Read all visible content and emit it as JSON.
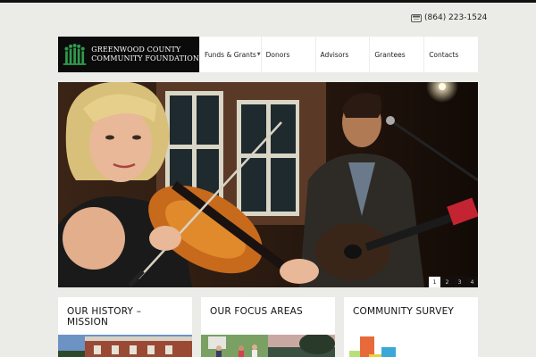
{
  "phone": {
    "number": "(864) 223-1524",
    "icon": "phone-icon"
  },
  "logo": {
    "line1": "GREENWOOD COUNTY",
    "line2": "COMMUNITY FOUNDATION",
    "mark_icon": "tree-people-icon",
    "mark_color": "#2f9a4d"
  },
  "nav": {
    "items": [
      {
        "label": "Funds & Grants",
        "has_dropdown": true
      },
      {
        "label": "Donors"
      },
      {
        "label": "Advisors"
      },
      {
        "label": "Grantees"
      },
      {
        "label": "Contacts"
      }
    ]
  },
  "hero": {
    "pager": [
      "1",
      "2",
      "3",
      "4"
    ],
    "active_slide": 1
  },
  "cards": [
    {
      "title": "OUR HISTORY – MISSION"
    },
    {
      "title": "OUR FOCUS AREAS"
    },
    {
      "title": "COMMUNITY SURVEY"
    }
  ],
  "colors": {
    "background": "#ebebe7",
    "logo_bg": "#0b0b0b",
    "brand_green": "#2f9a4d"
  }
}
